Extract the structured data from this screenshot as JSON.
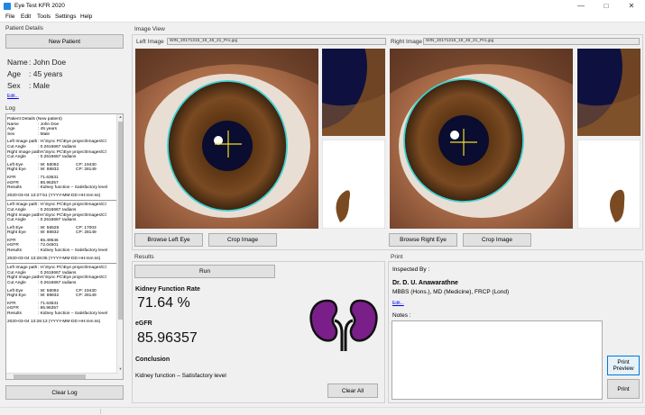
{
  "window": {
    "title": "Eye Test KFR 2020"
  },
  "menu": [
    "File",
    "Edit",
    "Tools",
    "Settings",
    "Help"
  ],
  "patient": {
    "section_title": "Patient Details",
    "new_patient_label": "New Patient",
    "name_label": "Name",
    "name_value": ": John Doe",
    "age_label": "Age",
    "age_value": ": 45 years",
    "sex_label": "Sex",
    "sex_value": ": Male",
    "edit_link": "Edit..."
  },
  "log": {
    "section_title": "Log",
    "clear_label": "Clear Log",
    "entries": [
      {
        "k": "Patient Details (New patient)",
        "v": "",
        "w": ""
      },
      {
        "k": "Name",
        "v": ": John Doe",
        "w": ""
      },
      {
        "k": "Age",
        "v": ": 45 years",
        "w": ""
      },
      {
        "k": "Sex",
        "v": ": Male",
        "w": ""
      },
      {
        "k": "",
        "v": "",
        "w": ""
      },
      {
        "k": "Left Image path",
        "v": ": H:\\Sync PC\\Eye project\\Images\\Cl",
        "w": ""
      },
      {
        "k": "Cut Angle",
        "v": ": 0.2616667 radians",
        "w": ""
      },
      {
        "k": "Right Image path",
        "v": ": H:\\Sync PC\\Eye project\\Images\\Cl",
        "w": ""
      },
      {
        "k": "Cut Angle",
        "v": ": 0.2616667 radians",
        "w": ""
      },
      {
        "k": "",
        "v": "",
        "w": ""
      },
      {
        "k": "Left Eye",
        "v": ": W: 58092",
        "w": "CP: 19430"
      },
      {
        "k": "Right Eye",
        "v": ": W: 88832",
        "w": "CP: 28149"
      },
      {
        "k": "",
        "v": "",
        "w": ""
      },
      {
        "k": "KFR",
        "v": ": 71.63631",
        "w": ""
      },
      {
        "k": "eGFR",
        "v": ": 85.96357",
        "w": ""
      },
      {
        "k": "Results",
        "v": ": Kidney function – Satisfactory level",
        "w": ""
      },
      {
        "k": "",
        "v": "",
        "w": ""
      },
      {
        "k": "2020-03-04 13:27:51 (YYYY-MM-DD  HH:mm:ss)",
        "v": "",
        "w": ""
      },
      {
        "k": "---",
        "v": "",
        "w": ""
      },
      {
        "k": "Left Image path",
        "v": ": H:\\Sync PC\\Eye project\\Images\\Cl",
        "w": ""
      },
      {
        "k": "Cut Angle",
        "v": ": 0.2616667 radians",
        "w": ""
      },
      {
        "k": "Right Image path",
        "v": ": H:\\Sync PC\\Eye project\\Images\\Cl",
        "w": ""
      },
      {
        "k": "Cut Angle",
        "v": ": 0.2616667 radians",
        "w": ""
      },
      {
        "k": "",
        "v": "",
        "w": ""
      },
      {
        "k": "Left Eye",
        "v": ": W: 56528",
        "w": "CP: 17003"
      },
      {
        "k": "Right Eye",
        "v": ": W: 88832",
        "w": "CP: 28149"
      },
      {
        "k": "",
        "v": "",
        "w": ""
      },
      {
        "k": "KFR",
        "v": ": 65.49546",
        "w": ""
      },
      {
        "k": "eGFR",
        "v": ": 72.04501",
        "w": ""
      },
      {
        "k": "Results",
        "v": ": Kidney function – Satisfactory level",
        "w": ""
      },
      {
        "k": "",
        "v": "",
        "w": ""
      },
      {
        "k": "2020-03-04 13:28:05 (YYYY-MM-DD  HH:mm:ss)",
        "v": "",
        "w": ""
      },
      {
        "k": "---",
        "v": "",
        "w": ""
      },
      {
        "k": "Left Image path",
        "v": ": H:\\Sync PC\\Eye project\\Images\\Cl",
        "w": ""
      },
      {
        "k": "Cut Angle",
        "v": ": 0.2616667 radians",
        "w": ""
      },
      {
        "k": "Right Image path",
        "v": ": H:\\Sync PC\\Eye project\\Images\\Cl",
        "w": ""
      },
      {
        "k": "Cut Angle",
        "v": ": 0.2616667 radians",
        "w": ""
      },
      {
        "k": "",
        "v": "",
        "w": ""
      },
      {
        "k": "Left Eye",
        "v": ": W: 58092",
        "w": "CP: 19430"
      },
      {
        "k": "Right Eye",
        "v": ": W: 88832",
        "w": "CP: 28149"
      },
      {
        "k": "",
        "v": "",
        "w": ""
      },
      {
        "k": "KFR",
        "v": ": 71.63631",
        "w": ""
      },
      {
        "k": "eGFR",
        "v": ": 85.96357",
        "w": ""
      },
      {
        "k": "Results",
        "v": ": Kidney function – Satisfactory level",
        "w": ""
      },
      {
        "k": "",
        "v": "",
        "w": ""
      },
      {
        "k": "2020-03-04 13:28:13 (YYYY-MM-DD  HH:mm:ss)",
        "v": "",
        "w": ""
      }
    ]
  },
  "image_view": {
    "section_title": "Image View",
    "left_label": "Left Image",
    "left_file": "WIN_20171215_19_45_21_Pro.jpg",
    "right_label": "Right Image",
    "right_file": "WIN_20171215_19_46_21_Pro.jpg",
    "browse_left": "Browse Left Eye",
    "crop_left": "Crop Image",
    "browse_right": "Browse Right Eye",
    "crop_right": "Crop Image"
  },
  "results": {
    "section_title": "Results",
    "run_label": "Run",
    "kfr_label": "Kidney Function Rate",
    "kfr_value": "71.64 %",
    "egfr_label": "eGFR",
    "egfr_value": "85.96357",
    "conclusion_label": "Conclusion",
    "conclusion_value": "Kidney function – Satisfactory level",
    "clear_all_label": "Clear All"
  },
  "print": {
    "section_title": "Print",
    "inspected_label": "Inspected By :",
    "doctor_name": "Dr. D. U. Anawarathne",
    "doctor_quals": "MBBS (Hons.), MD (Medicine), FRCP (Lond)",
    "edit_link": "Edit...",
    "notes_label": "Notes :",
    "preview_label_1": "Print",
    "preview_label_2": "Preview",
    "print_label": "Print"
  },
  "colors": {
    "iris_ring": "#3fd0d0",
    "crosshair": "#f0e020",
    "kidney": "#7a1f8a"
  }
}
